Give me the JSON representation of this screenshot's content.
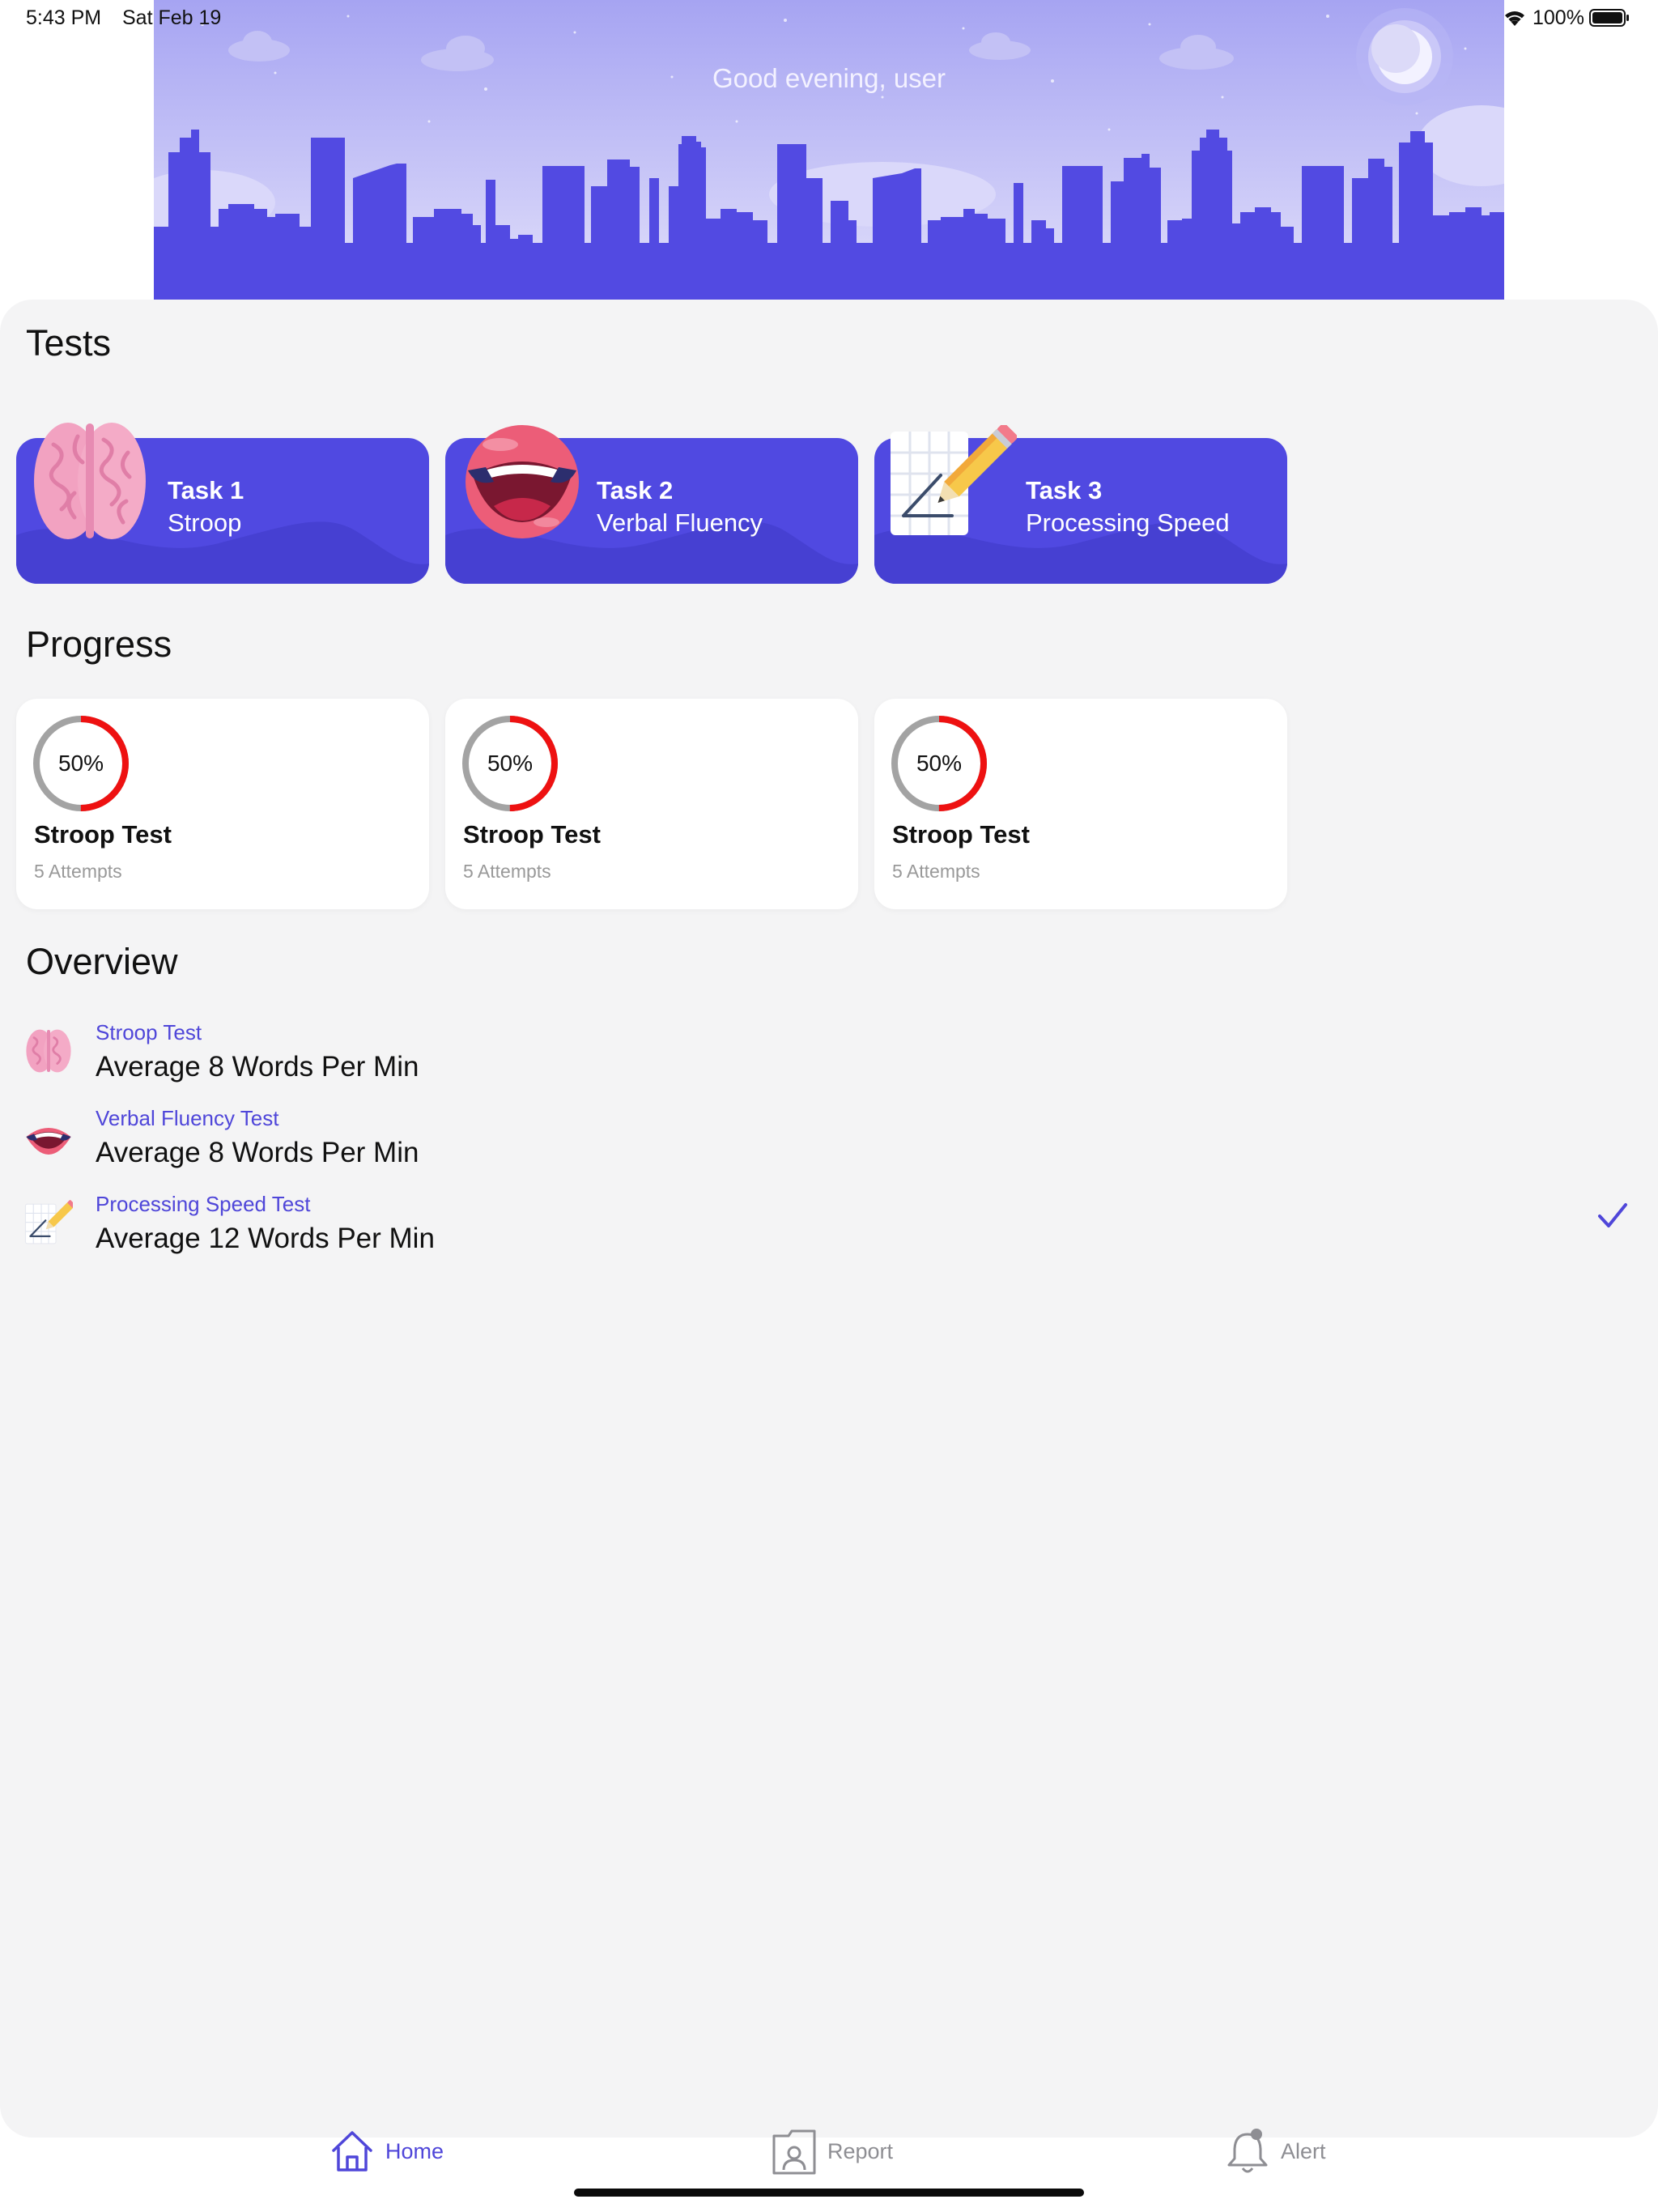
{
  "status_bar": {
    "time": "5:43 PM",
    "date": "Sat Feb 19",
    "battery": "100%"
  },
  "header": {
    "greeting": "Good evening, user"
  },
  "tests": {
    "title": "Tests",
    "cards": [
      {
        "title": "Task 1",
        "subtitle": "Stroop",
        "icon": "brain-icon"
      },
      {
        "title": "Task 2",
        "subtitle": "Verbal Fluency",
        "icon": "mouth-icon"
      },
      {
        "title": "Task 3",
        "subtitle": "Processing Speed",
        "icon": "notepad-pencil-icon"
      }
    ]
  },
  "progress": {
    "title": "Progress",
    "cards": [
      {
        "percent": "50%",
        "progress": 0.5,
        "name": "Stroop Test",
        "attempts": "5 Attempts"
      },
      {
        "percent": "50%",
        "progress": 0.5,
        "name": "Stroop Test",
        "attempts": "5 Attempts"
      },
      {
        "percent": "50%",
        "progress": 0.5,
        "name": "Stroop Test",
        "attempts": "5 Attempts"
      }
    ]
  },
  "overview": {
    "title": "Overview",
    "items": [
      {
        "category": "Stroop Test",
        "value": "Average 8 Words Per Min",
        "icon": "brain-icon",
        "checked": false
      },
      {
        "category": "Verbal Fluency Test",
        "value": "Average 8 Words Per Min",
        "icon": "mouth-icon",
        "checked": false
      },
      {
        "category": "Processing Speed Test",
        "value": "Average 12 Words Per Min",
        "icon": "notepad-pencil-icon",
        "checked": true
      }
    ]
  },
  "tab_bar": {
    "tabs": [
      {
        "label": "Home",
        "icon": "home-icon",
        "active": true
      },
      {
        "label": "Report",
        "icon": "report-icon",
        "active": false
      },
      {
        "label": "Alert",
        "icon": "bell-icon",
        "active": false
      }
    ]
  },
  "colors": {
    "accent": "#5049e1",
    "sky_top": "#a6a4f2",
    "skyline": "#524ae2",
    "ring_progress": "#ee1111",
    "ring_track": "#a3a3a3",
    "background": "#f4f4f5"
  }
}
